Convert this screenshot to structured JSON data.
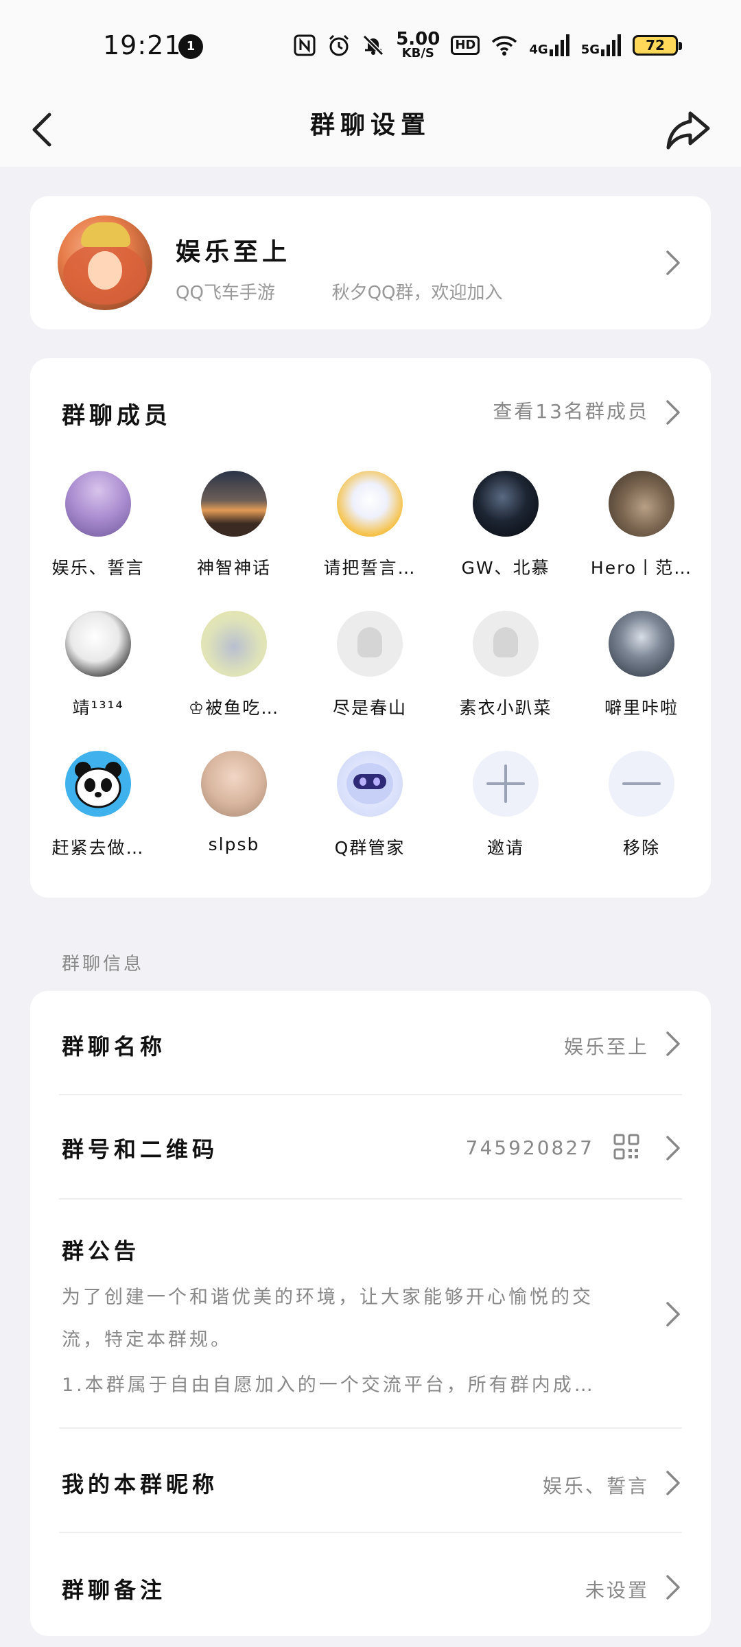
{
  "status_bar": {
    "time": "19:21",
    "notification_count": "1",
    "net_speed_value": "5.00",
    "net_speed_unit": "KB/S",
    "hd_label": "HD",
    "network_4g": "4G",
    "network_5g": "5G",
    "battery": "72"
  },
  "header": {
    "title": "群聊设置"
  },
  "group": {
    "name": "娱乐至上",
    "description": "QQ飞车手游          秋夕QQ群，欢迎加入"
  },
  "members": {
    "title": "群聊成员",
    "view_all": "查看13名群成员",
    "items": [
      {
        "name": "娱乐、誓言",
        "avatar": "purple-tree-avatar"
      },
      {
        "name": "神智神话",
        "avatar": "sunset-avatar"
      },
      {
        "name": "请把誓言…",
        "avatar": "anime-girl-avatar"
      },
      {
        "name": "GW、北慕",
        "avatar": "dark-portrait-avatar"
      },
      {
        "name": "Hero丨范…",
        "avatar": "cat-avatar"
      },
      {
        "name": "靖¹³¹⁴",
        "avatar": "white-hair-avatar"
      },
      {
        "name": "♔被鱼吃…",
        "avatar": "grey-cat-cartoon-avatar"
      },
      {
        "name": "尽是春山",
        "avatar": "default-avatar"
      },
      {
        "name": "素衣小趴菜",
        "avatar": "default-avatar"
      },
      {
        "name": "噼里咔啦",
        "avatar": "masked-boy-avatar"
      },
      {
        "name": "赶紧去做…",
        "avatar": "panda-avatar"
      },
      {
        "name": "slpsb",
        "avatar": "portrait-avatar"
      },
      {
        "name": "Q群管家",
        "avatar": "robot-avatar"
      },
      {
        "name": "邀请",
        "avatar": "plus-icon"
      },
      {
        "name": "移除",
        "avatar": "minus-icon"
      }
    ]
  },
  "info_section": {
    "label": "群聊信息",
    "group_name_label": "群聊名称",
    "group_name_value": "娱乐至上",
    "group_id_label": "群号和二维码",
    "group_id_value": "745920827",
    "notice_label": "群公告",
    "notice_line1": "为了创建一个和谐优美的环境，让大家能够开心愉悦的交",
    "notice_line2": "流，特定本群规。",
    "notice_line3": "1.本群属于自由自愿加入的一个交流平台，所有群内成…",
    "nickname_label": "我的本群昵称",
    "nickname_value": "娱乐、誓言",
    "remark_label": "群聊备注",
    "remark_value": "未设置"
  }
}
